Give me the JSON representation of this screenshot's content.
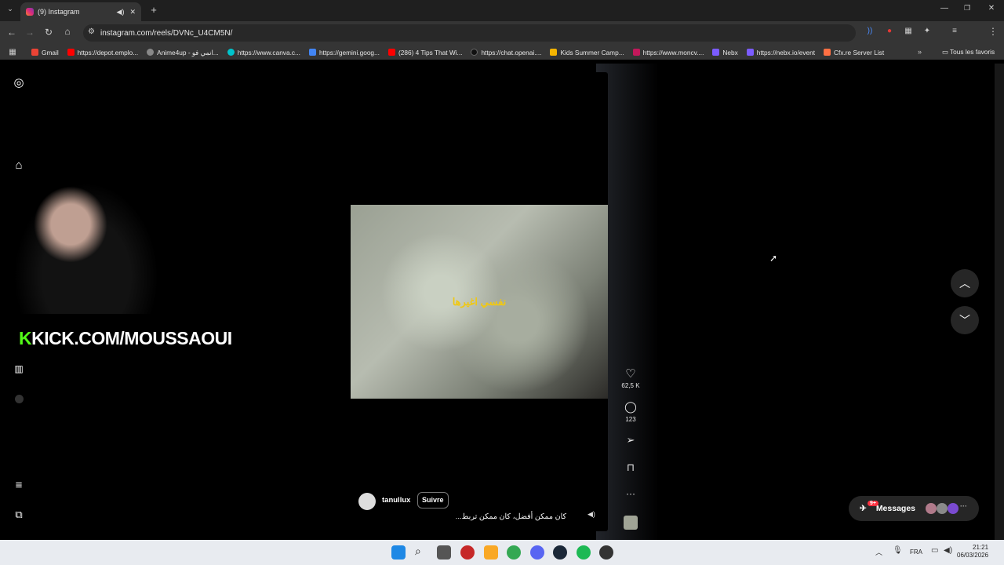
{
  "browser": {
    "tab_title": "(9) Instagram",
    "url": "instagram.com/reels/DVNc_U4CM5N/",
    "bookmarks": [
      "Gmail",
      "https://depot.emplo...",
      "Anime4up - انمي فو...",
      "https://www.canva.c...",
      "https://gemini.goog...",
      "(286) 4 Tips That Wi...",
      "https://chat.openai....",
      "Kids Summer Camp...",
      "https://www.moncv....",
      "Nebx",
      "https://nebx.io/event",
      "Cfx.re Server List"
    ],
    "all_favorites": "Tous les favoris",
    "bookmark_colors": [
      "#ea4335",
      "#ff0000",
      "#888888",
      "#00c4cc",
      "#4285f4",
      "#ff0000",
      "#222222",
      "#f4b400",
      "#c2185b",
      "#7b5cff",
      "#7b5cff",
      "#ff7043"
    ]
  },
  "overlay": {
    "kick_k": "K",
    "kick_text": "KICK.COM/MOUSSAOUI"
  },
  "reel": {
    "caption_overlay": "نفسي اغيرها",
    "username": "tanullux",
    "follow_label": "Suivre",
    "description": "كان ممكن أفضل، كان ممكن تربط...",
    "likes": "62,5 K",
    "comments": "123"
  },
  "messages": {
    "label": "Messages",
    "badge": "9+"
  },
  "taskbar": {
    "lang": "FRA",
    "time": "21:21",
    "date": "06/03/2026"
  },
  "icons": {
    "like": "heart-icon",
    "comment": "comment-icon",
    "share": "send-icon",
    "save": "bookmark-icon",
    "more": "more-icon"
  }
}
